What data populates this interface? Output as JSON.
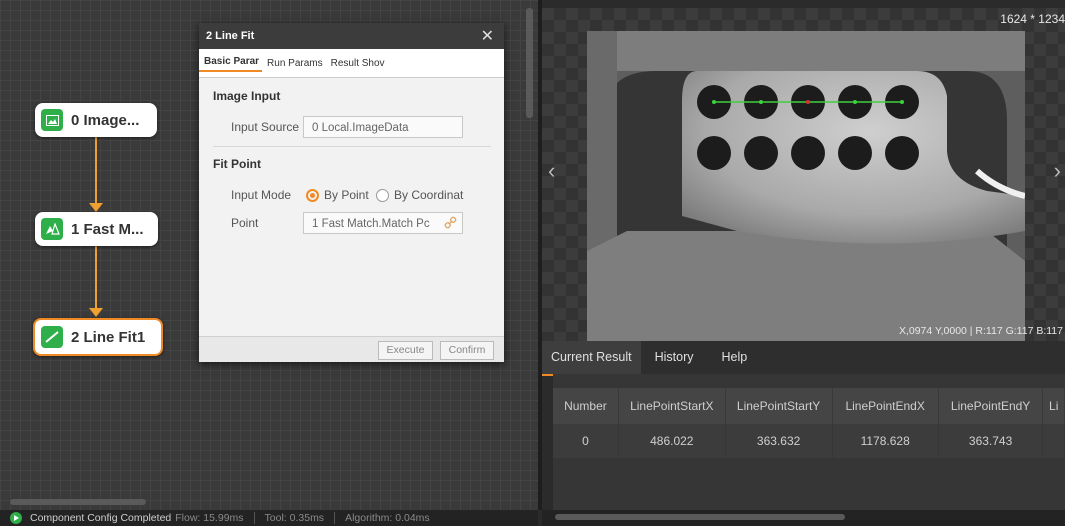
{
  "flow": {
    "nodes": [
      {
        "label": "0 Image...",
        "icon": "image-icon"
      },
      {
        "label": "1 Fast M...",
        "icon": "match-icon"
      },
      {
        "label": "2 Line Fit1",
        "icon": "line-icon"
      }
    ]
  },
  "dialog": {
    "title": "2 Line Fit",
    "close": "✕",
    "tabs": [
      "Basic Parar",
      "Run Params",
      "Result Shov"
    ],
    "image_input": {
      "heading": "Image Input",
      "source_label": "Input Source",
      "source_value": "0 Local.ImageData"
    },
    "fit_point": {
      "heading": "Fit Point",
      "mode_label": "Input Mode",
      "mode_options": [
        "By Point",
        "By Coordinat"
      ],
      "point_label": "Point",
      "point_value": "1 Fast Match.Match Pc"
    },
    "buttons": {
      "execute": "Execute",
      "confirm": "Confirm"
    }
  },
  "viewer": {
    "dimensions": "1624 * 1234",
    "coords": "X,0974 Y,0000 | R:117 G:117 B:117",
    "nav_prev": "‹",
    "nav_next": "›"
  },
  "results": {
    "tabs": [
      "Current Result",
      "History",
      "Help"
    ],
    "columns": [
      "Number",
      "LinePointStartX",
      "LinePointStartY",
      "LinePointEndX",
      "LinePointEndY",
      "Li"
    ],
    "rows": [
      [
        "0",
        "486.022",
        "363.632",
        "1178.628",
        "363.743",
        ""
      ]
    ]
  },
  "status": {
    "message": "Component Config Completed",
    "flow": "Flow: 15.99ms",
    "tool": "Tool: 0.35ms",
    "algorithm": "Algorithm: 0.04ms"
  },
  "colors": {
    "accent": "#f08a24",
    "node_green": "#2eaf49",
    "fit_line": "#3cd23c"
  }
}
